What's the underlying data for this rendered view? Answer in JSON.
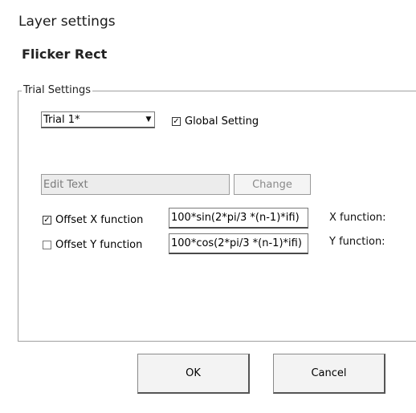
{
  "dialog": {
    "title": "Layer settings",
    "layer_name": "Flicker Rect"
  },
  "trial_settings": {
    "legend": "Trial Settings",
    "trial_select": {
      "selected": "Trial 1*"
    },
    "global_setting": {
      "label": "Global Setting",
      "checked": true
    },
    "edit_text": {
      "value": "Edit Text"
    },
    "change_button": {
      "label": "Change"
    },
    "offset_x": {
      "label": "Offset X function",
      "checked": true,
      "value": "100*sin(2*pi/3 *(n-1)*ifi)",
      "side_label": "X function:"
    },
    "offset_y": {
      "label": "Offset Y function",
      "checked": false,
      "value": "100*cos(2*pi/3 *(n-1)*ifi)",
      "side_label": "Y function:"
    }
  },
  "buttons": {
    "ok": "OK",
    "cancel": "Cancel"
  },
  "icons": {
    "dropdown": "chevron-down-icon",
    "check": "checkmark-icon"
  }
}
